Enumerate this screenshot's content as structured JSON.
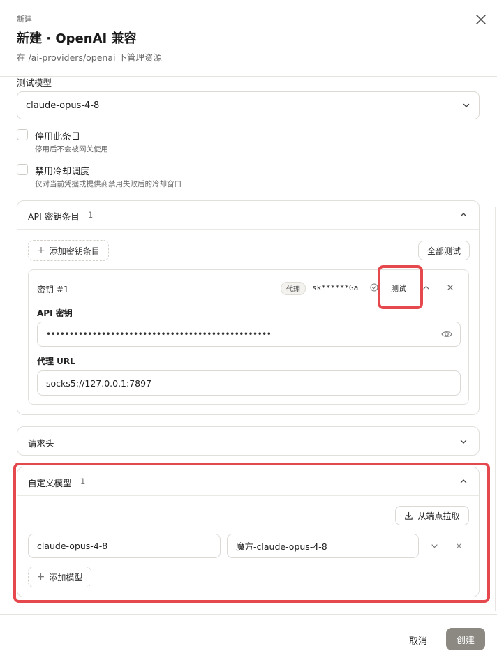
{
  "header": {
    "breadcrumb": "新建",
    "title": "新建 · OpenAI 兼容",
    "subtitle": "在 /ai-providers/openai 下管理资源",
    "close_icon": "close-icon"
  },
  "test_model": {
    "label": "测试模型",
    "value": "claude-opus-4-8"
  },
  "options": [
    {
      "label": "停用此条目",
      "description": "停用后不会被网关使用",
      "checked": false
    },
    {
      "label": "禁用冷却调度",
      "description": "仅对当前凭据或提供商禁用失败后的冷却窗口",
      "checked": false
    }
  ],
  "api_keys": {
    "title": "API 密钥条目",
    "count": "1",
    "add_label": "添加密钥条目",
    "test_all_label": "全部测试",
    "entries": [
      {
        "name": "密钥 #1",
        "badge": "代理",
        "masked_key": "sk******Ga",
        "test_label": "测试",
        "api_key_label": "API 密钥",
        "api_key_value": "•••••••••••••••••••••••••••••••••••••••••••••••••",
        "proxy_label": "代理 URL",
        "proxy_value": "socks5://127.0.0.1:7897"
      }
    ]
  },
  "headers_section": {
    "title": "请求头",
    "expanded": false
  },
  "custom_models": {
    "title": "自定义模型",
    "count": "1",
    "fetch_label": "从端点拉取",
    "add_label": "添加模型",
    "models": [
      {
        "name": "claude-opus-4-8",
        "alias": "魔方-claude-opus-4-8"
      }
    ]
  },
  "footer": {
    "cancel_label": "取消",
    "create_label": "创建"
  },
  "colors": {
    "highlight": "#e5484d",
    "primary_disabled": "#8c8983",
    "border": "#dcd9d4"
  }
}
